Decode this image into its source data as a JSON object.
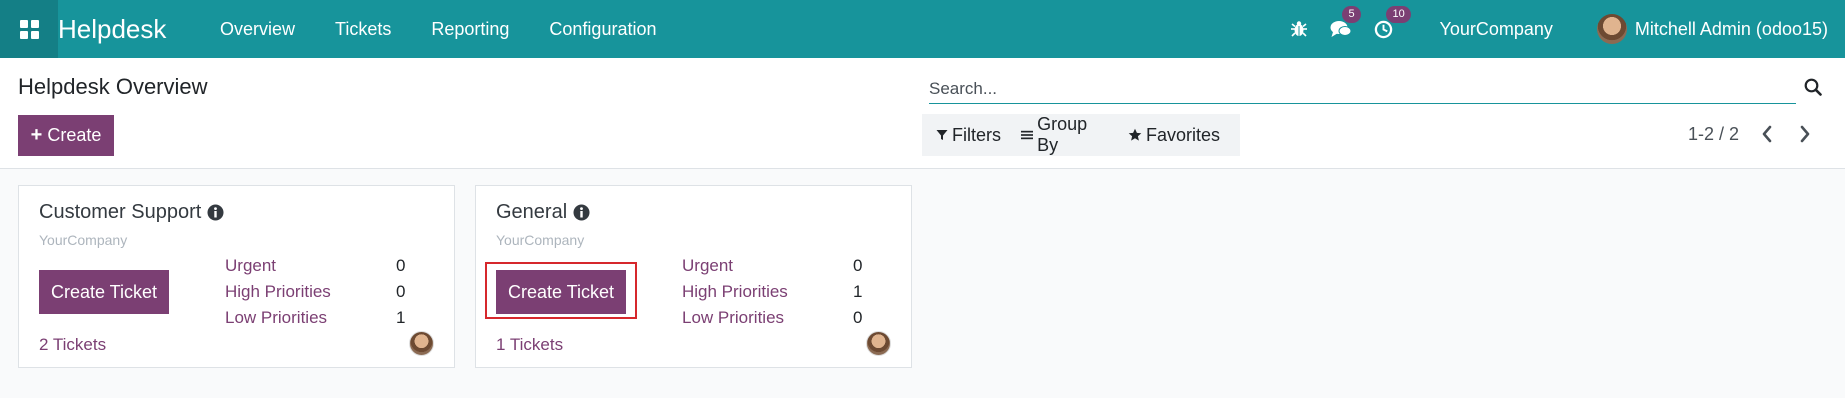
{
  "navbar": {
    "brand": "Helpdesk",
    "menu": [
      "Overview",
      "Tickets",
      "Reporting",
      "Configuration"
    ],
    "messages_badge": "5",
    "activities_badge": "10",
    "company": "YourCompany",
    "user": "Mitchell Admin (odoo15)"
  },
  "control": {
    "title": "Helpdesk Overview",
    "create_label": "Create",
    "search_placeholder": "Search...",
    "filters_label": "Filters",
    "groupby_label": "Group By",
    "favorites_label": "Favorites",
    "pager": "1-2 / 2"
  },
  "cards": [
    {
      "name": "Customer Support",
      "company": "YourCompany",
      "button": "Create Ticket",
      "stats": [
        {
          "label": "Urgent",
          "value": "0"
        },
        {
          "label": "High Priorities",
          "value": "0"
        },
        {
          "label": "Low Priorities",
          "value": "1"
        }
      ],
      "tickets": "2 Tickets"
    },
    {
      "name": "General",
      "company": "YourCompany",
      "button": "Create Ticket",
      "stats": [
        {
          "label": "Urgent",
          "value": "0"
        },
        {
          "label": "High Priorities",
          "value": "1"
        },
        {
          "label": "Low Priorities",
          "value": "0"
        }
      ],
      "tickets": "1 Tickets"
    }
  ],
  "colors": {
    "navbar": "#17949b",
    "primary": "#7b3f73",
    "highlight": "#d6282c"
  }
}
